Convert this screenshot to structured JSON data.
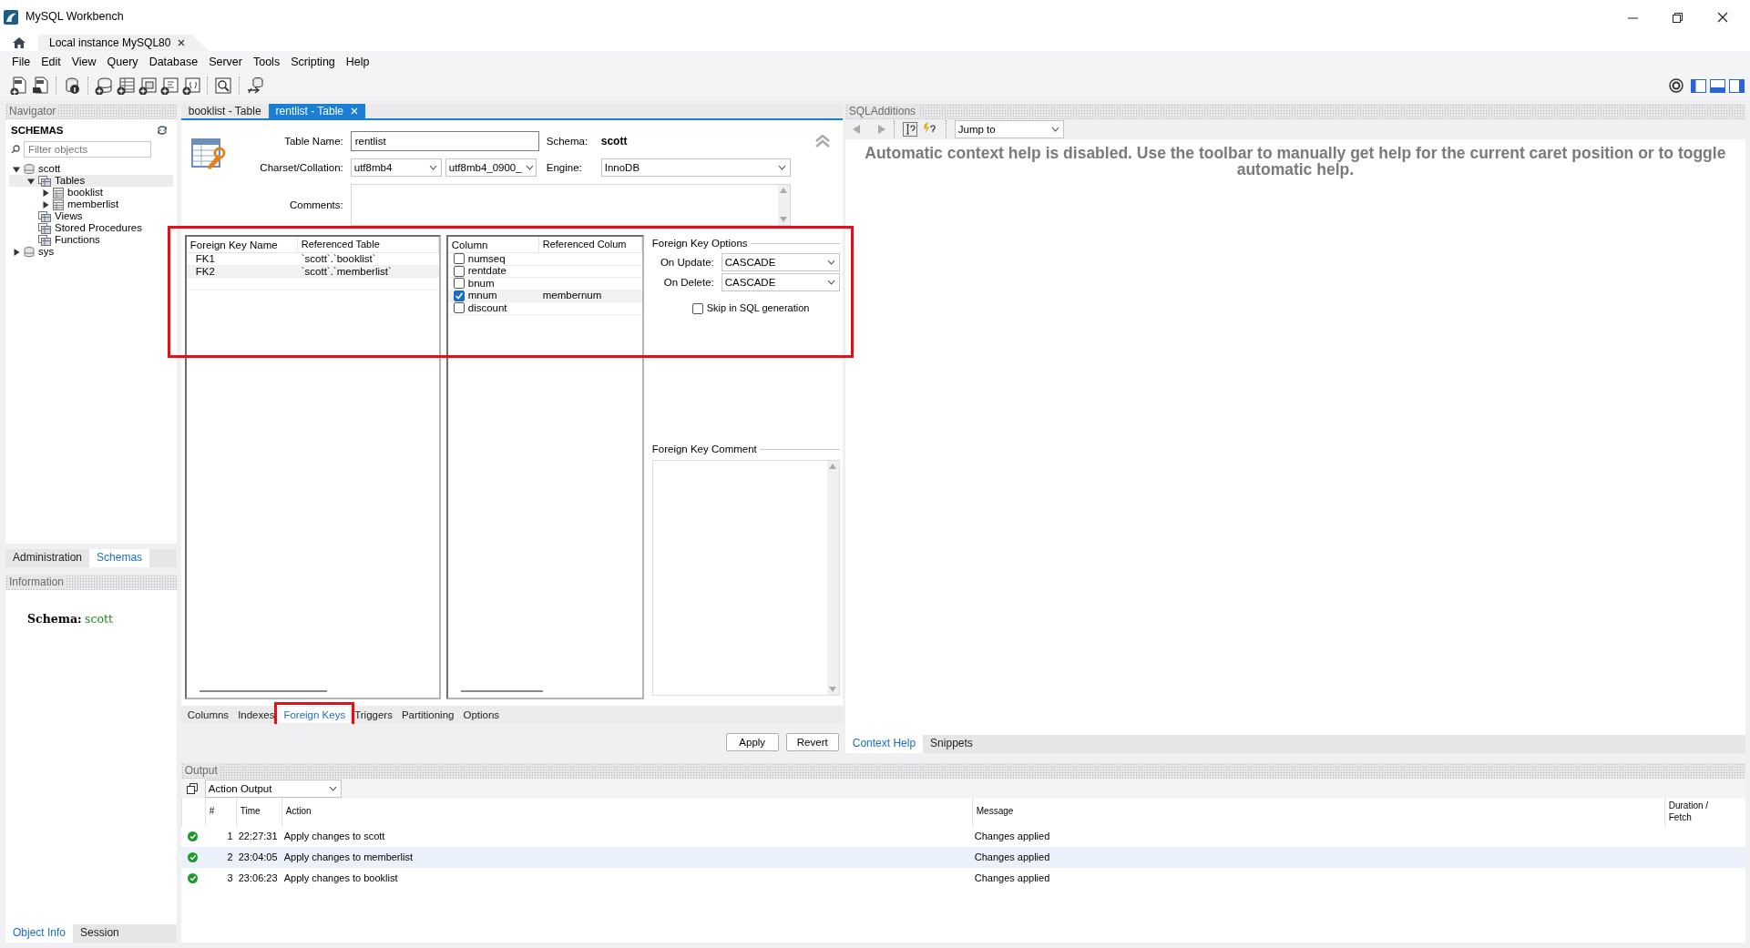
{
  "window": {
    "title": "MySQL Workbench"
  },
  "connection_tabs": [
    {
      "label": "Local instance MySQL80",
      "selected": true
    }
  ],
  "menu": [
    "File",
    "Edit",
    "View",
    "Query",
    "Database",
    "Server",
    "Tools",
    "Scripting",
    "Help"
  ],
  "navigator": {
    "title": "Navigator",
    "heading": "SCHEMAS",
    "filter": {
      "placeholder": "Filter objects"
    },
    "tree": [
      {
        "label": "scott",
        "kind": "database",
        "expanded": true,
        "selected": false,
        "children": [
          {
            "label": "Tables",
            "kind": "folder",
            "expanded": true,
            "selected": true,
            "children": [
              {
                "label": "booklist",
                "kind": "table",
                "expanded": false,
                "selected": false
              },
              {
                "label": "memberlist",
                "kind": "table",
                "expanded": false,
                "selected": false
              }
            ]
          },
          {
            "label": "Views",
            "kind": "folder",
            "selected": false
          },
          {
            "label": "Stored Procedures",
            "kind": "folder",
            "selected": false
          },
          {
            "label": "Functions",
            "kind": "folder",
            "selected": false
          }
        ]
      },
      {
        "label": "sys",
        "kind": "database",
        "expanded": false,
        "selected": false
      }
    ],
    "tabs": [
      {
        "label": "Administration",
        "selected": false
      },
      {
        "label": "Schemas",
        "selected": true
      }
    ]
  },
  "information": {
    "title": "Information",
    "label": "Schema:",
    "value": "scott",
    "tabs": [
      {
        "label": "Object Info",
        "selected": true
      },
      {
        "label": "Session",
        "selected": false
      }
    ]
  },
  "editor": {
    "tabs": [
      {
        "label": "booklist - Table",
        "selected": false,
        "closable": false
      },
      {
        "label": "rentlist - Table",
        "selected": true,
        "closable": true
      }
    ],
    "table_name": {
      "label": "Table Name:",
      "value": "rentlist"
    },
    "schema": {
      "label": "Schema:",
      "value": "scott"
    },
    "charset": {
      "label": "Charset/Collation:",
      "charset": "utf8mb4",
      "collation": "utf8mb4_0900_"
    },
    "engine": {
      "label": "Engine:",
      "value": "InnoDB"
    },
    "comments": {
      "label": "Comments:"
    },
    "foreign_keys": {
      "highlighted": true,
      "columns": [
        "Foreign Key Name",
        "Referenced Table"
      ],
      "rows": [
        {
          "name": "FK1",
          "table": "`scott`.`booklist`",
          "selected": false
        },
        {
          "name": "FK2",
          "table": "`scott`.`memberlist`",
          "selected": true
        }
      ]
    },
    "fk_columns": {
      "columns": [
        "Column",
        "Referenced Colum"
      ],
      "rows": [
        {
          "name": "numseq",
          "checked": false,
          "selected": false
        },
        {
          "name": "rentdate",
          "checked": false,
          "selected": false
        },
        {
          "name": "bnum",
          "checked": false,
          "selected": false
        },
        {
          "name": "mnum",
          "checked": true,
          "selected": true,
          "referenced": "membernum"
        },
        {
          "name": "discount",
          "checked": false,
          "selected": false
        }
      ]
    },
    "fk_options": {
      "title": "Foreign Key Options",
      "on_update": {
        "label": "On Update:",
        "value": "CASCADE"
      },
      "on_delete": {
        "label": "On Delete:",
        "value": "CASCADE"
      },
      "skip": {
        "label": "Skip in SQL generation",
        "checked": false
      },
      "comment_title": "Foreign Key Comment"
    },
    "bottom_tabs": [
      {
        "label": "Columns",
        "selected": false,
        "highlighted": false
      },
      {
        "label": "Indexes",
        "selected": false,
        "highlighted": false
      },
      {
        "label": "Foreign Keys",
        "selected": true,
        "highlighted": true
      },
      {
        "label": "Triggers",
        "selected": false,
        "highlighted": false
      },
      {
        "label": "Partitioning",
        "selected": false,
        "highlighted": false
      },
      {
        "label": "Options",
        "selected": false,
        "highlighted": false
      }
    ],
    "buttons": [
      "Apply",
      "Revert"
    ]
  },
  "sql_additions": {
    "title": "SQLAdditions",
    "jump": "Jump to",
    "message": "Automatic context help is disabled. Use the toolbar to manually get help for the current caret position or to toggle automatic help.",
    "tabs": [
      {
        "label": "Context Help",
        "selected": true
      },
      {
        "label": "Snippets",
        "selected": false
      }
    ]
  },
  "output": {
    "title": "Output",
    "selector": "Action Output",
    "columns": [
      "#",
      "Time",
      "Action",
      "Message",
      "Duration / Fetch"
    ],
    "rows": [
      {
        "number": "1",
        "time": "22:27:31",
        "action": "Apply changes to scott",
        "message": "Changes applied",
        "kind": "success",
        "selected": false
      },
      {
        "number": "2",
        "time": "23:04:05",
        "action": "Apply changes to memberlist",
        "message": "Changes applied",
        "kind": "success",
        "selected": true
      },
      {
        "number": "3",
        "time": "23:06:23",
        "action": "Apply changes to booklist",
        "message": "Changes applied",
        "kind": "success",
        "selected": false
      }
    ]
  }
}
